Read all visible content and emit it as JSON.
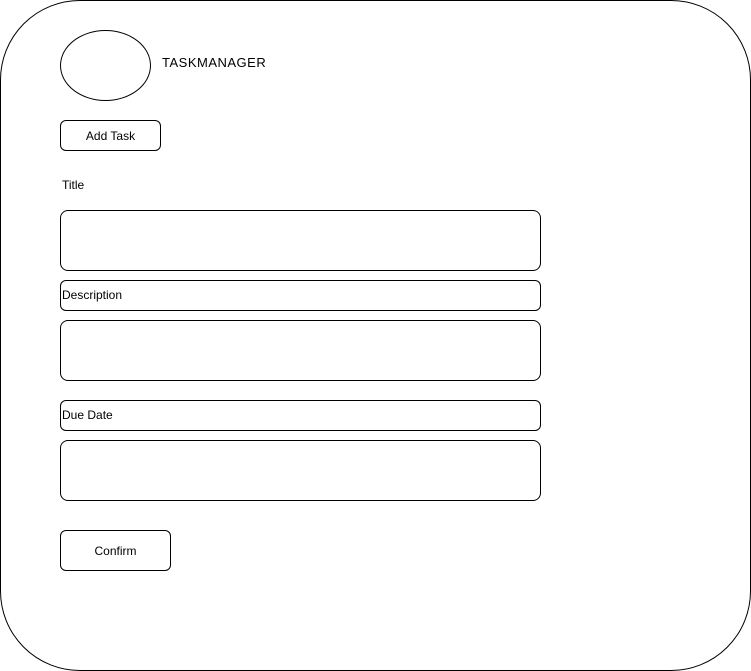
{
  "header": {
    "app_title": "TASKMANAGER"
  },
  "toolbar": {
    "add_task_label": "Add Task"
  },
  "form": {
    "title_label": "Title",
    "title_value": "",
    "description_label": "Description",
    "description_value": "",
    "due_date_label": "Due Date",
    "due_date_value": "",
    "confirm_label": "Confirm"
  }
}
